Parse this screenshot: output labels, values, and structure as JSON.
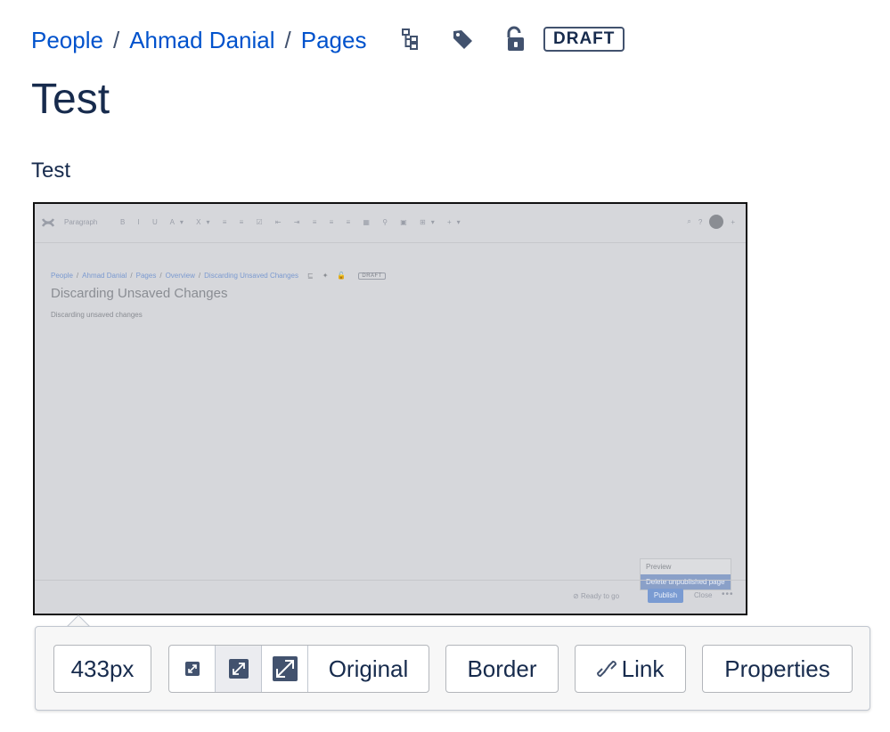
{
  "breadcrumb": {
    "items": [
      "People",
      "Ahmad Danial",
      "Pages"
    ],
    "separator": "/"
  },
  "page_meta": {
    "icons": [
      "page-tree-icon",
      "label-tag-icon",
      "unlock-icon"
    ],
    "status": "DRAFT"
  },
  "page": {
    "title": "Test",
    "body": "Test"
  },
  "embedded_screenshot": {
    "toolbar": {
      "style_dropdown": "Paragraph",
      "format_glyphs": "B I U A▾ X▾ ≡ ≡ ☑ ⇤ ⇥ ≡ ≡ ≡ ▦ ⚲ ▣ ⊞▾ +▾",
      "help": "?",
      "search": "⌕",
      "add": "+"
    },
    "breadcrumb": [
      "People",
      "Ahmad Danial",
      "Pages",
      "Overview",
      "Discarding Unsaved Changes"
    ],
    "status": "DRAFT",
    "title": "Discarding Unsaved Changes",
    "body": "Discarding unsaved changes",
    "menu": {
      "items": [
        "Preview",
        "Delete unpublished page"
      ],
      "selected": "Delete unpublished page"
    },
    "footer": {
      "status": "Ready to go",
      "publish": "Publish",
      "close": "Close",
      "more": "•••"
    }
  },
  "image_toolbar": {
    "width_value": "433px",
    "size_options": [
      "small-size-icon",
      "medium-size-icon",
      "large-size-icon"
    ],
    "active_size": "medium-size-icon",
    "original_label": "Original",
    "border_label": "Border",
    "link_label": "Link",
    "properties_label": "Properties"
  },
  "colors": {
    "link": "#0052cc",
    "text": "#172b4d",
    "icon": "#42526e"
  }
}
